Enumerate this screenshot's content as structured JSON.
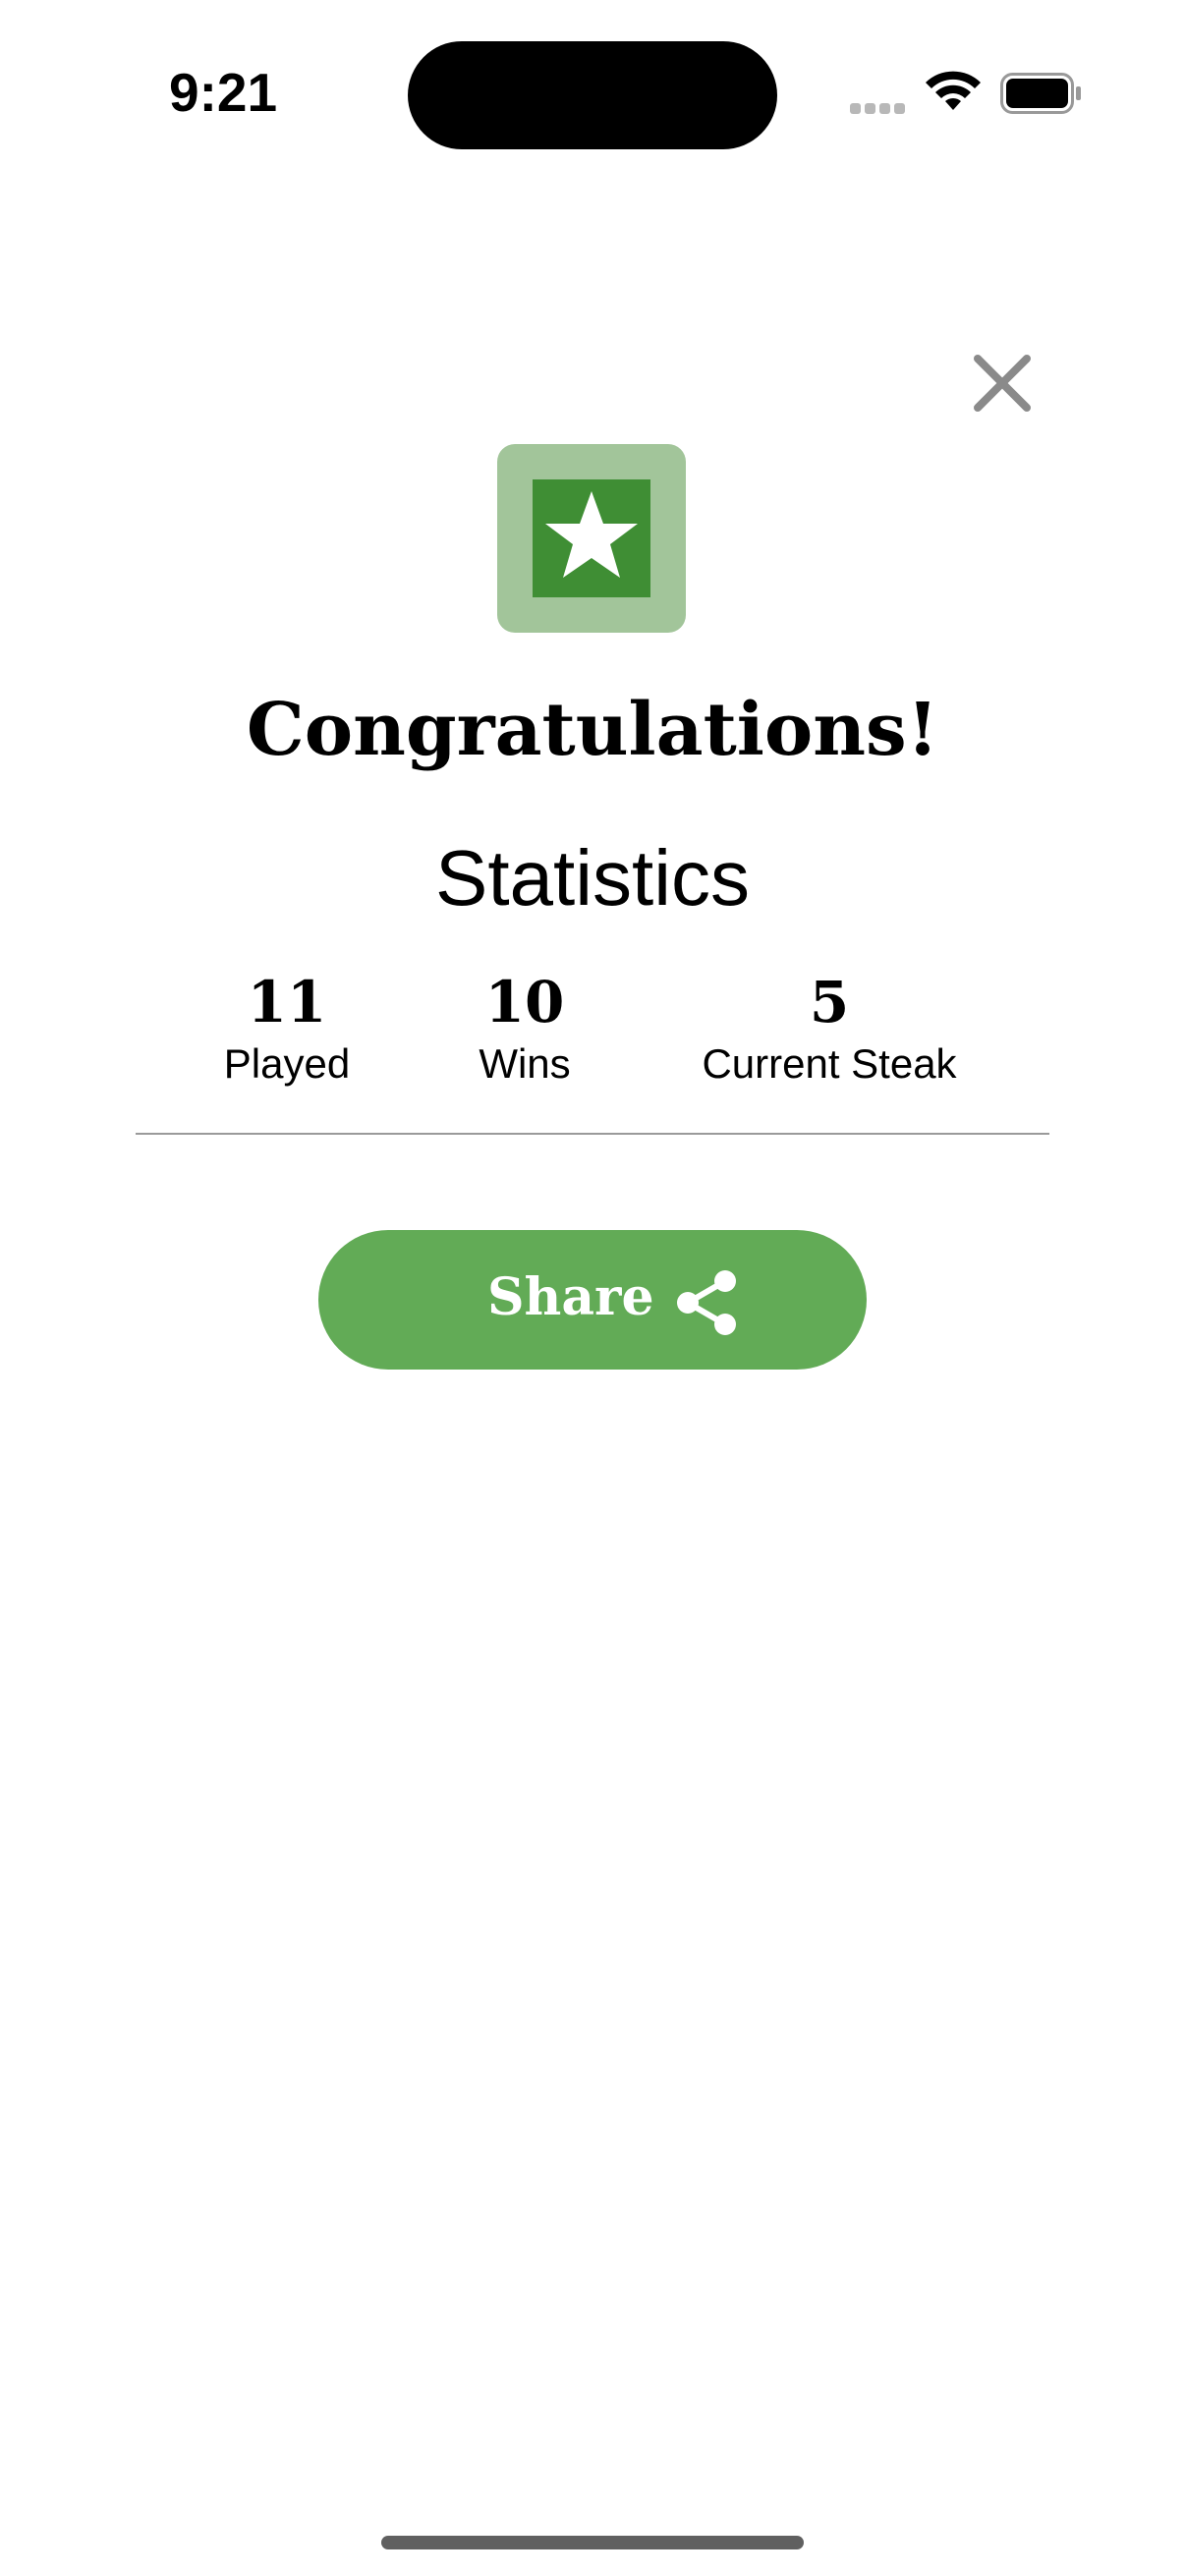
{
  "status_bar": {
    "time": "9:21"
  },
  "dialog": {
    "heading": "Congratulations!",
    "statistics_title": "Statistics",
    "stats": [
      {
        "value": "11",
        "label": "Played"
      },
      {
        "value": "10",
        "label": "Wins"
      },
      {
        "value": "5",
        "label": "Current Steak"
      }
    ],
    "share_label": "Share"
  },
  "icons": {
    "close": "close-icon",
    "badge": "star-icon",
    "share": "share-icon"
  },
  "colors": {
    "accent": "#62ab56",
    "badge_outer": "#a2c59a",
    "badge_inner": "#3f8e34"
  }
}
